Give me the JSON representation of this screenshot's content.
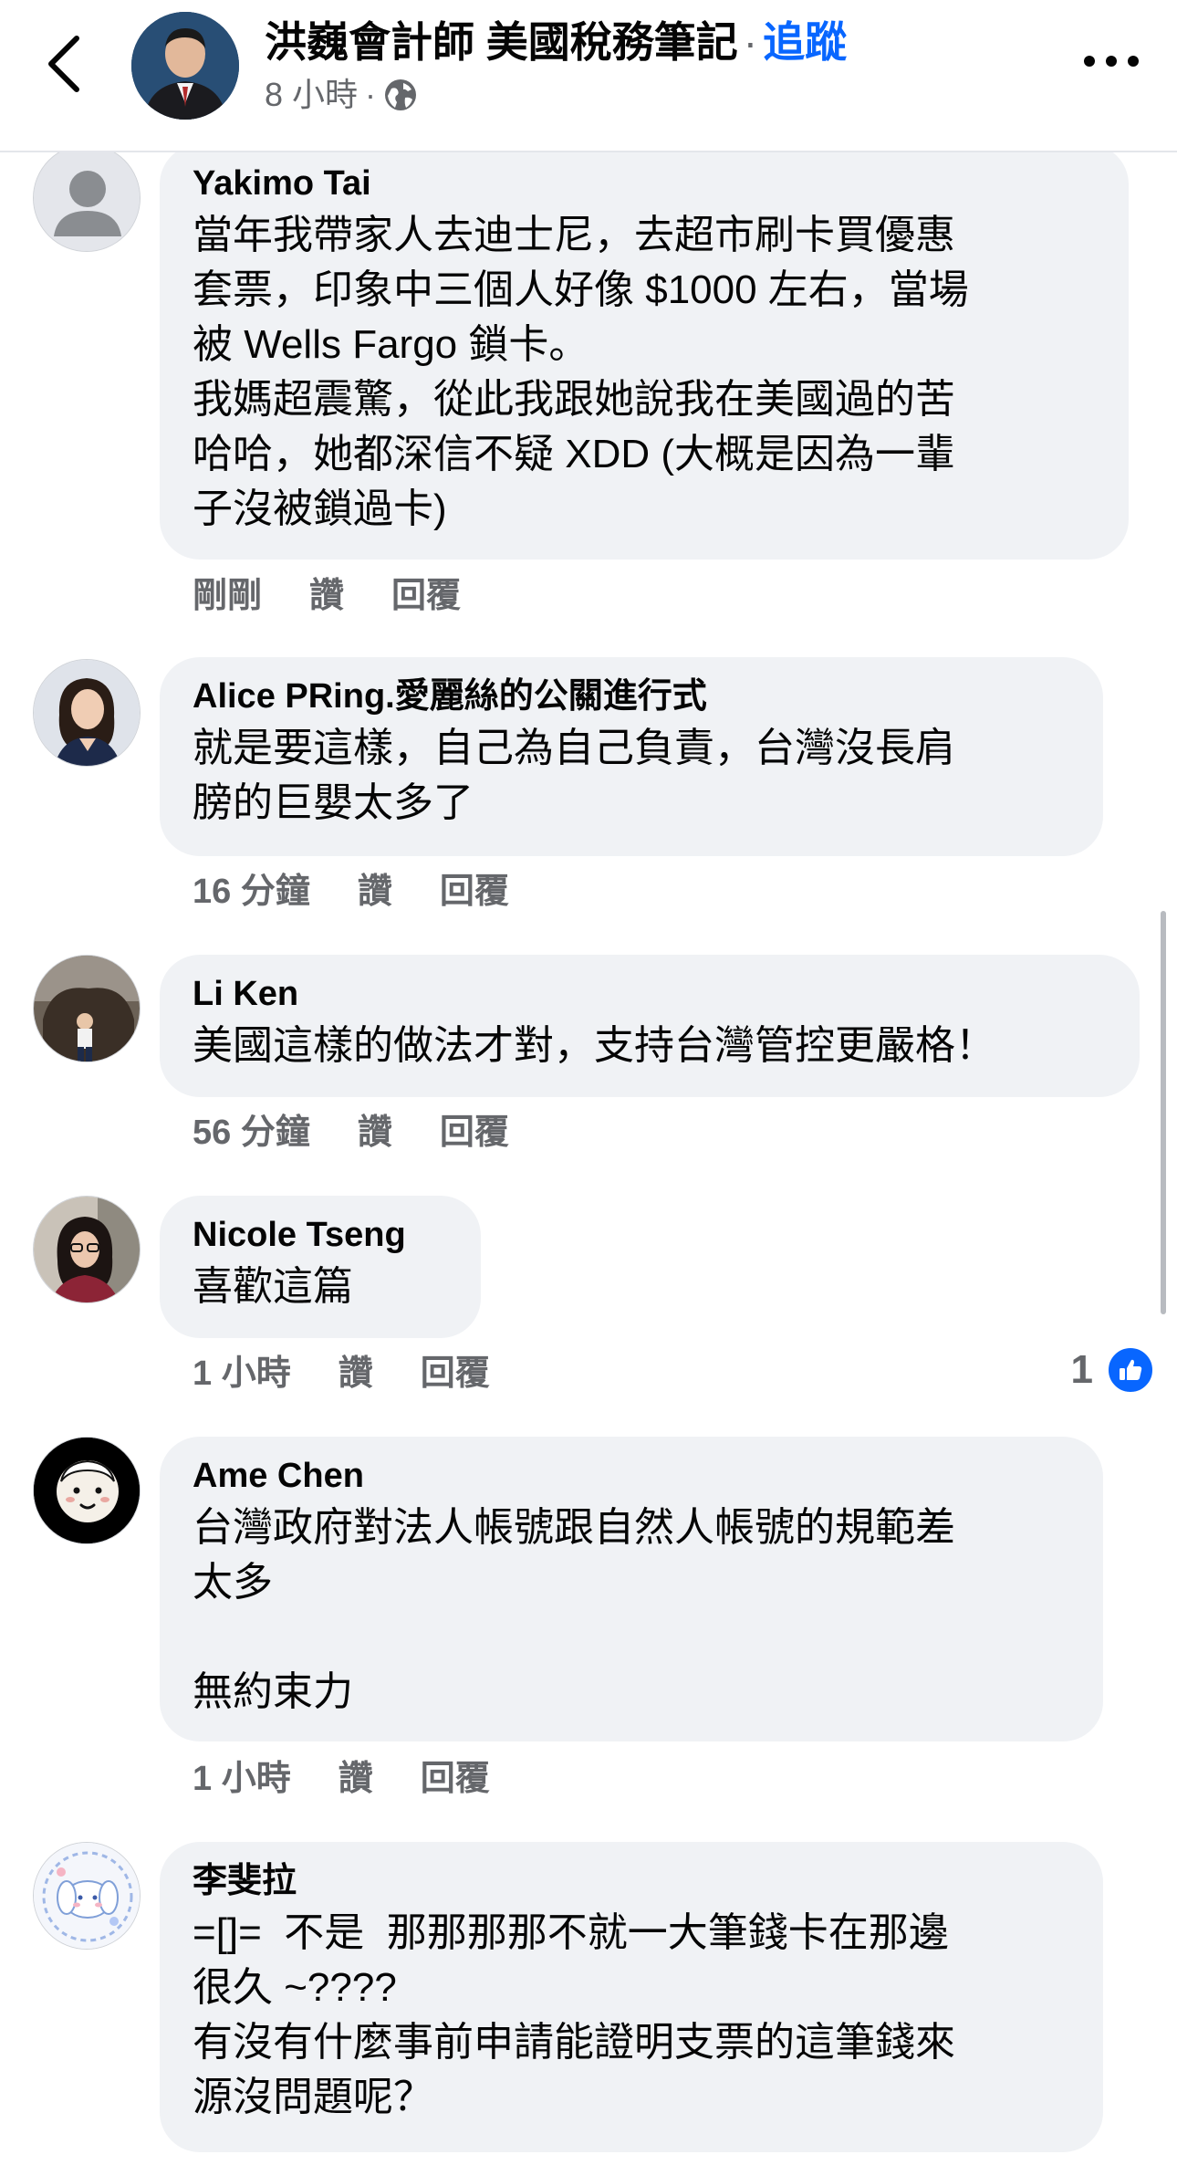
{
  "header": {
    "page_name": "洪巍會計師 美國稅務筆記",
    "separator": "·",
    "follow_label": "追蹤",
    "post_time": "8 小時",
    "meta_separator": "·",
    "privacy_icon": "globe-icon",
    "back_icon": "chevron-left-icon",
    "more_icon": "more-horizontal-icon"
  },
  "actions_labels": {
    "like": "讚",
    "reply": "回覆"
  },
  "comments": [
    {
      "author": "Yakimo Tai",
      "text": "當年我帶家人去迪士尼，去超市刷卡買優惠\n套票，印象中三個人好像 $1000 左右，當場\n被 Wells Fargo 鎖卡。\n我媽超震驚，從此我跟她說我在美國過的苦\n哈哈，她都深信不疑 XDD (大概是因為一輩\n子沒被鎖過卡)",
      "time": "剛剛",
      "avatar": "default-avatar-icon"
    },
    {
      "author": "Alice PRing.愛麗絲的公關進行式",
      "text": "就是要這樣，自己為自己負責，台灣沒長肩\n膀的巨嬰太多了",
      "time": "16 分鐘",
      "avatar": "woman-portrait"
    },
    {
      "author": "Li Ken",
      "text": "美國這樣的做法才對，支持台灣管控更嚴格！",
      "time": "56 分鐘",
      "avatar": "statue-photo"
    },
    {
      "author": "Nicole Tseng",
      "text": "喜歡這篇",
      "time": "1 小時",
      "avatar": "woman-glasses-photo",
      "reaction_count": "1",
      "reaction_icon": "like-icon"
    },
    {
      "author": "Ame  Chen",
      "text": "台灣政府對法人帳號跟自然人帳號的規範差\n太多\n\n無約束力",
      "time": "1 小時",
      "avatar": "cartoon-face"
    },
    {
      "author": "李斐拉",
      "text": "=[]=  不是  那那那那不就一大筆錢卡在那邊\n很久 ~????\n有沒有什麼事前申請能證明支票的這筆錢來\n源沒問題呢？",
      "time": "",
      "avatar": "cartoon-bunny"
    }
  ],
  "colors": {
    "accent": "#0866ff",
    "bubble": "#f0f2f5",
    "secondary_text": "#65676b",
    "text": "#050505"
  }
}
